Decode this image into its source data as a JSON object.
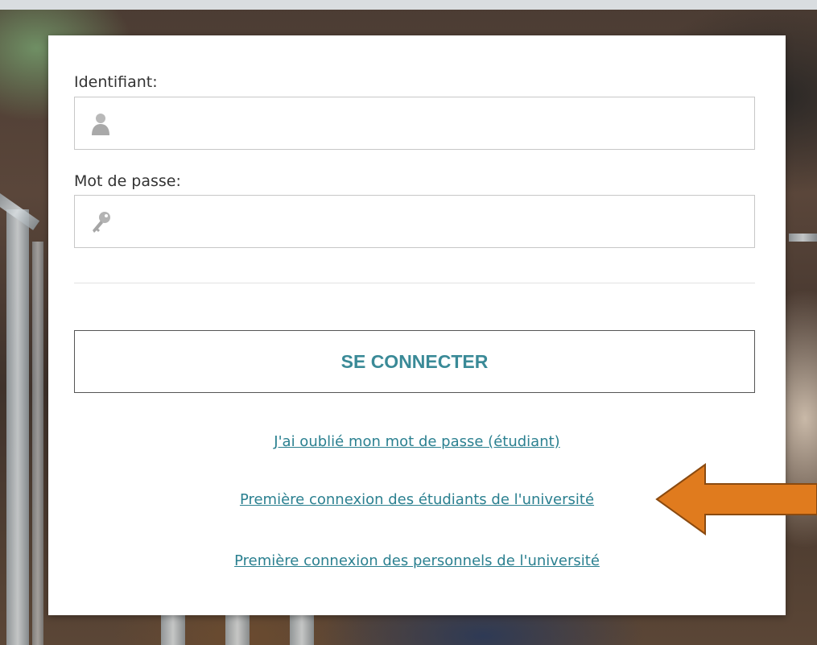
{
  "login": {
    "username_label": "Identifiant:",
    "username_value": "",
    "password_label": "Mot de passe:",
    "password_value": "",
    "submit_label": "SE CONNECTER"
  },
  "links": {
    "forgot_password": "J'ai oublié mon mot de passe (étudiant)",
    "first_login_students": "Première connexion des étudiants de l'université",
    "first_login_staff": "Première connexion des personnels de l'université"
  },
  "icons": {
    "username": "user-icon",
    "password": "key-icon"
  },
  "colors": {
    "accent": "#3a8a97",
    "link": "#2b8090",
    "arrow": "#e07b1e"
  }
}
